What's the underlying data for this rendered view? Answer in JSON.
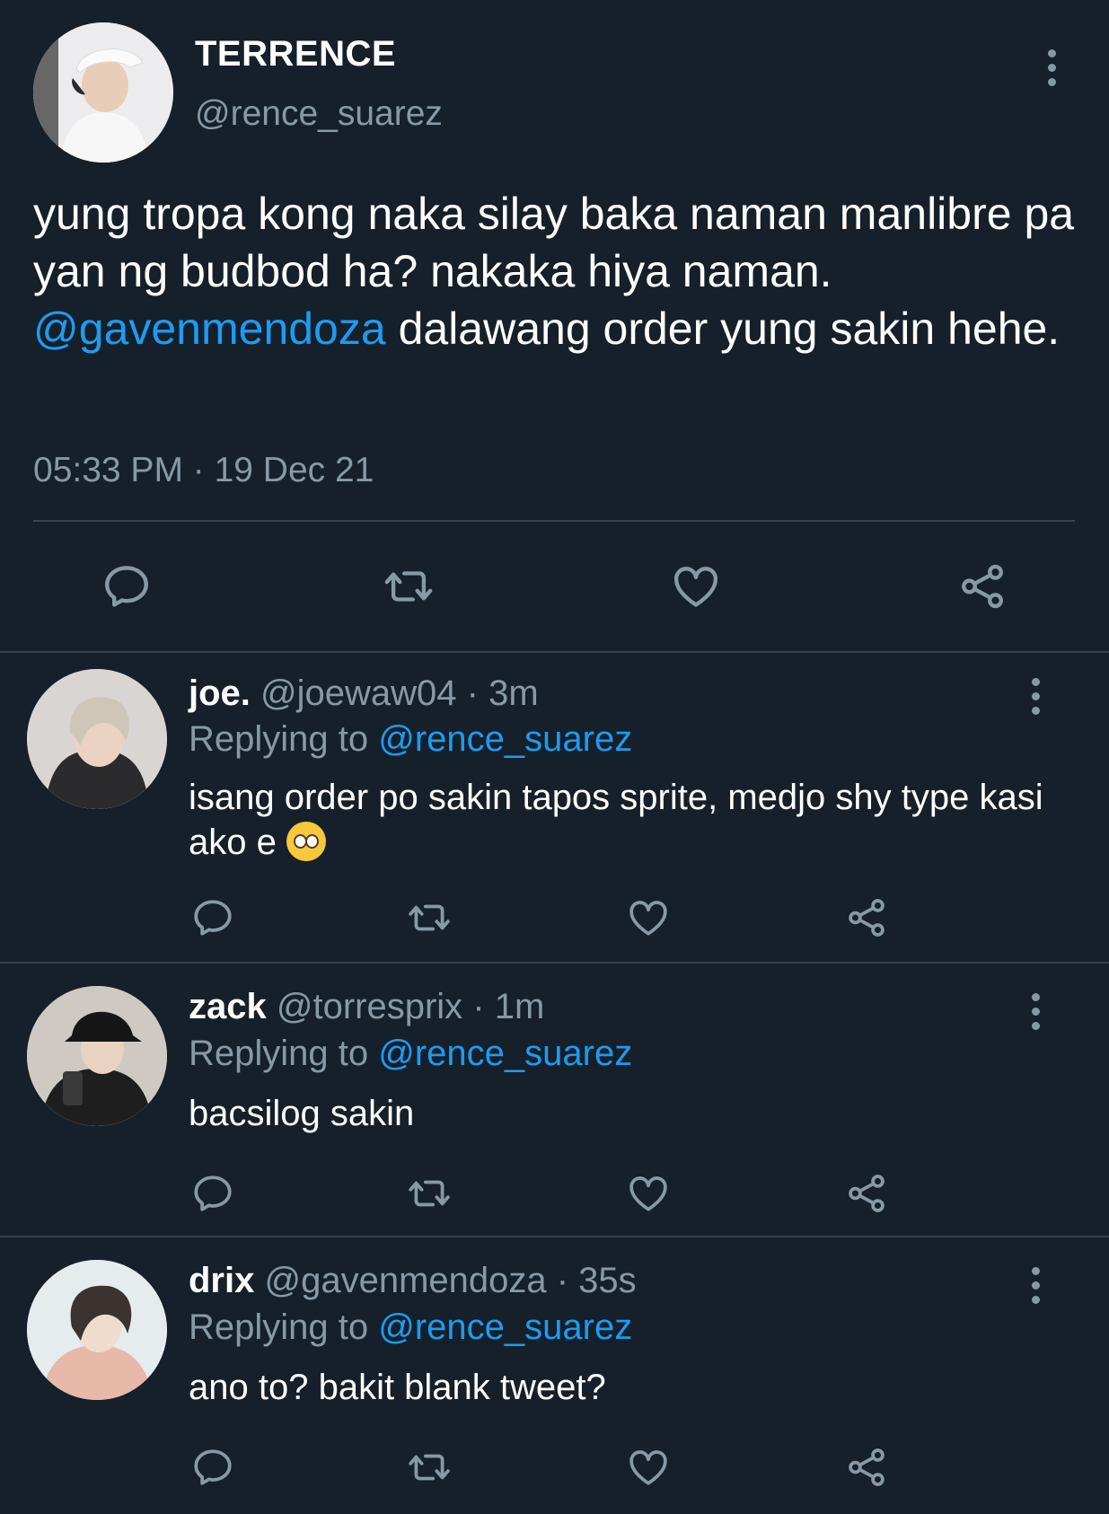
{
  "main_tweet": {
    "name": "TERRENCE",
    "handle": "@rence_suarez",
    "text_part1": "yung tropa kong naka silay baka naman manlibre pa yan ng budbod ha? nakaka hiya naman. ",
    "mention": "@gavenmendoza",
    "text_part2": " dalawang order yung sakin hehe.",
    "timestamp": "05:33 PM · 19 Dec 21"
  },
  "replies": [
    {
      "name": "joe.",
      "handle": "@joewaw04",
      "time": "· 3m",
      "replying_label": "Replying to",
      "replying_to": "@rence_suarez",
      "text": "isang order po sakin tapos sprite, medjo shy type kasi ako e",
      "emoji": "pleading-face"
    },
    {
      "name": "zack",
      "handle": "@torresprix",
      "time": "· 1m",
      "replying_label": "Replying to",
      "replying_to": "@rence_suarez",
      "text": "bacsilog sakin"
    },
    {
      "name": "drix",
      "handle": "@gavenmendoza",
      "time": "· 35s",
      "replying_label": "Replying to",
      "replying_to": "@rence_suarez",
      "text": "ano to? bakit blank tweet?"
    }
  ],
  "colors": {
    "background": "#15202b",
    "text": "#ffffff",
    "secondary": "#8899a6",
    "accent": "#1d9bf0",
    "divider": "#38444d"
  },
  "icons": [
    "reply-icon",
    "retweet-icon",
    "like-icon",
    "share-icon",
    "more-options-icon"
  ]
}
